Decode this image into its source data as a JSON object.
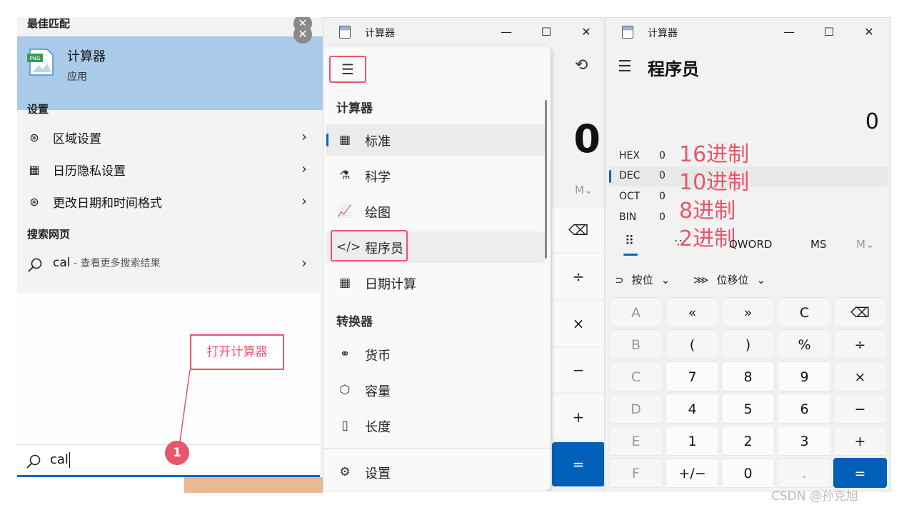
{
  "search": {
    "best_match_header": "最佳匹配",
    "best_match_title": "计算器",
    "best_match_subtitle": "应用",
    "settings_header": "设置",
    "settings_items": [
      {
        "label": "区域设置",
        "icon": "globe-icon"
      },
      {
        "label": "日历隐私设置",
        "icon": "calendar-icon"
      },
      {
        "label": "更改日期和时间格式",
        "icon": "globe-icon"
      }
    ],
    "web_header": "搜索网页",
    "web_query": "cal",
    "web_hint": " - 查看更多搜索结果",
    "query": "cal",
    "callout": "打开计算器",
    "step_badge": "1",
    "close_glyph": "✕"
  },
  "calc_standard": {
    "title": "计算器",
    "nav_section_calculator": "计算器",
    "nav_items": [
      "标准",
      "科学",
      "绘图",
      "程序员",
      "日期计算"
    ],
    "nav_section_converter": "转换器",
    "converter_items": [
      "货币",
      "容量",
      "长度"
    ],
    "settings_label": "设置",
    "display": "0",
    "memory_btn": "M⌄",
    "ops": [
      "⌫",
      "÷",
      "×",
      "−",
      "+",
      "="
    ]
  },
  "calc_programmer": {
    "title": "计算器",
    "mode": "程序员",
    "display": "0",
    "radix": [
      {
        "name": "HEX",
        "value": "0"
      },
      {
        "name": "DEC",
        "value": "0"
      },
      {
        "name": "OCT",
        "value": "0"
      },
      {
        "name": "BIN",
        "value": "0"
      }
    ],
    "annotations": [
      "16进制",
      "10进制",
      "8进制",
      "2进制"
    ],
    "word_size": "QWORD",
    "memory_store": "MS",
    "memory_menu": "M⌄",
    "bitwise": "按位",
    "bitshift": "位移位",
    "keys": [
      [
        "A",
        "«",
        "»",
        "C",
        "⌫"
      ],
      [
        "B",
        "(",
        ")",
        "%",
        "÷"
      ],
      [
        "C",
        "7",
        "8",
        "9",
        "×"
      ],
      [
        "D",
        "4",
        "5",
        "6",
        "−"
      ],
      [
        "E",
        "1",
        "2",
        "3",
        "+"
      ],
      [
        "F",
        "+/−",
        "0",
        ".",
        "="
      ]
    ]
  },
  "window_controls": {
    "minimize": "—",
    "maximize": "☐",
    "close": "✕"
  },
  "watermark": "CSDN @孙克旭",
  "colors": {
    "accent": "#0067c0",
    "annotation": "#e8566c",
    "selection": "#a9cbe9"
  }
}
